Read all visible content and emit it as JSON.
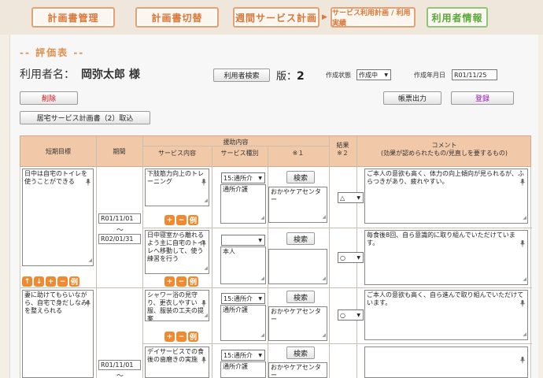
{
  "nav": {
    "tabs": [
      "計画書管理",
      "計画書切替",
      "週間サービス計画",
      "サービス利用計画 / 利用実績",
      "利用者情報"
    ],
    "arrow": "▶"
  },
  "section_title": "-- 評価表 --",
  "user": {
    "label": "利用者名：",
    "name": "岡弥太郎 様",
    "search_button": "利用者検索"
  },
  "version": {
    "label": "版：",
    "value": "2"
  },
  "status": {
    "label": "作成状態",
    "value": "作成中"
  },
  "created": {
    "label": "作成年月日",
    "value": "R01/11/25"
  },
  "buttons": {
    "delete": "削除",
    "print": "帳票出力",
    "register": "登録",
    "import": "居宅サービス計画書（2）取込"
  },
  "table": {
    "headers": {
      "goal": "短期目標",
      "period": "期間",
      "support": "援助内容",
      "service": "サービス内容",
      "type": "サービス種別",
      "note1": "※１",
      "result": "結果",
      "note2": "※２",
      "comment": "コメント",
      "comment_sub": "(効果が認められたもの/見直しを要するもの)"
    },
    "icon_labels": {
      "up": "↑",
      "down": "↓",
      "add": "+",
      "remove": "−",
      "example": "例"
    },
    "search_label": "検索",
    "goals": [
      {
        "text": "日中は自宅のトイレを使うことができる",
        "period_start": "R01/11/01",
        "period_sep": "～",
        "period_end": "R02/01/31",
        "services": [
          {
            "content": "下肢筋力向上のトレーニング",
            "type_code": "15:通所介",
            "type_name": "通所介護",
            "provider": "おかやケアセンター",
            "result": "△",
            "comment": "ご本人の意欲も高く、体力の向上傾向が見られるが、ふらつきがあり、疲れやすい。"
          },
          {
            "content": "日中寝室から離れるよう主に自宅のトイレへ移動して、使う練習を行う",
            "type_code": "",
            "type_name": "本人",
            "provider": "",
            "result": "○",
            "comment": "毎食後8回、自ら意識的に取り組んでいただけています。"
          }
        ]
      },
      {
        "text": "妻に助けてもらいながら、自宅で身だしなみを整えられる",
        "period_start": "R01/11/01",
        "period_sep": "～",
        "services": [
          {
            "content": "シャワー浴の見守り、更衣しやすい服、服装の工夫の提案",
            "type_code": "15:通所介",
            "type_name": "通所介護",
            "provider": "おかやケアセンター",
            "result": "○",
            "comment": "ご本人の意欲も高く、自ら進んで取り組んでいただけています。"
          },
          {
            "content": "デイサービスでの食後の歯磨きの実施",
            "type_code": "15:通所介",
            "type_name": "通所介護",
            "provider": "おかやケアセンター",
            "result": "",
            "comment": ""
          }
        ]
      }
    ]
  }
}
